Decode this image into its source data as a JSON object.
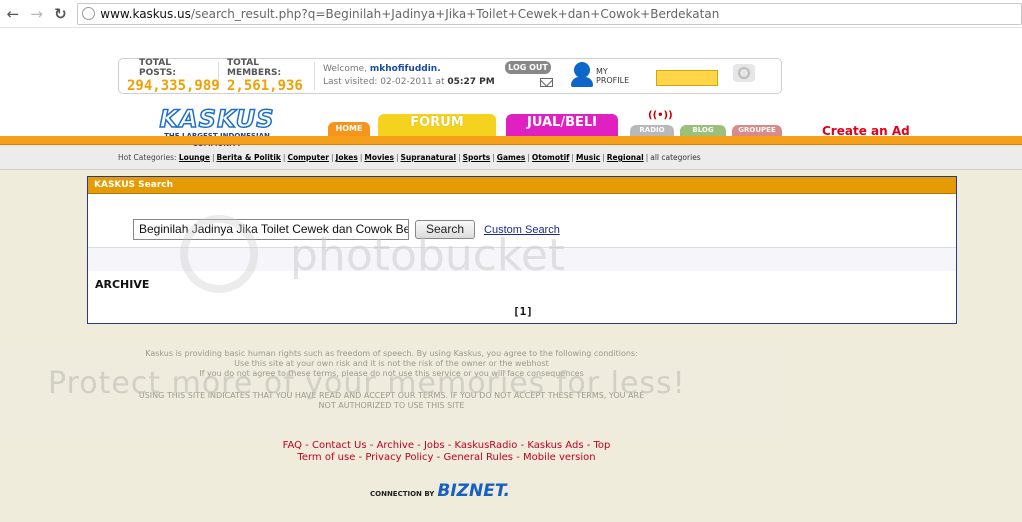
{
  "browser": {
    "back_icon": "back-arrow-icon",
    "forward_icon": "forward-arrow-icon",
    "reload_icon": "reload-icon",
    "url_host": "www.kaskus.us",
    "url_path": "/search_result.php?q=Beginilah+Jadinya+Jika+Toilet+Cewek+dan+Cowok+Berdekatan"
  },
  "stats": {
    "total_posts_label": "TOTAL POSTS:",
    "total_posts_value": "294,335,989",
    "total_members_label": "TOTAL MEMBERS:",
    "total_members_value": "2,561,936"
  },
  "user": {
    "welcome_prefix": "Welcome, ",
    "username": "mkhofifuddin.",
    "last_visited_prefix": "Last visited: 02-02-2011 at ",
    "last_visited_time": "05:27 PM",
    "logout_label": "LOG OUT",
    "profile_label_1": "MY",
    "profile_label_2": "PROFILE"
  },
  "logo": {
    "text": "KASKUS",
    "tagline": "THE LARGEST INDONESIAN COMMUNITY"
  },
  "tabs": {
    "home": "HOME",
    "forum": "FORUM",
    "jual_beli": "JUAL/BELI",
    "radio": "RADIO",
    "blog": "BLOG",
    "groupee": "GROUPEE"
  },
  "create_ad": "Create an Ad",
  "categories": {
    "label": "Hot Categories: ",
    "items": [
      "Lounge",
      "Berita & Politik",
      "Computer",
      "Jokes",
      "Movies",
      "Supranatural",
      "Sports",
      "Games",
      "Otomotif",
      "Music",
      "Regional"
    ],
    "all": "all categories"
  },
  "search_panel": {
    "title": "KASKUS Search",
    "query": "Beginilah Jadinya Jika Toilet Cewek dan Cowok Ber",
    "search_button": "Search",
    "custom_search": "Custom Search",
    "archive_label": "ARCHIVE",
    "pager": "[1]"
  },
  "watermarks": {
    "photobucket": "photobucket",
    "protect": "Protect more of your memories for less!"
  },
  "disclaimer": {
    "line1": "Kaskus is providing basic human rights such as freedom of speech. By using Kaskus, you agree to the following conditions:",
    "line2": "Use this site at your own risk and it is not the risk of the owner or the webhost",
    "line3": "If you do not agree to these terms, please do not use this service or you will face consequences",
    "line4": "USING THIS SITE INDICATES THAT YOU HAVE READ AND ACCEPT OUR TERMS. IF YOU DO NOT ACCEPT THESE TERMS, YOU ARE",
    "line5": "NOT AUTHORIZED TO USE THIS SITE"
  },
  "footer": {
    "row1": [
      "FAQ",
      "Contact Us",
      "Archive",
      "Jobs",
      "KaskusRadio",
      "Kaskus Ads",
      "Top"
    ],
    "row2": [
      "Term of use",
      "Privacy Policy",
      "General Rules",
      "Mobile version"
    ],
    "separator": " - "
  },
  "sponsor": {
    "connection_by": "CONNECTION BY",
    "brand": "BIZNET."
  },
  "colors": {
    "accent_orange": "#f5a01a",
    "stat_value": "#f0a000",
    "create_ad": "#e0001a",
    "footer_link": "#c00020"
  }
}
